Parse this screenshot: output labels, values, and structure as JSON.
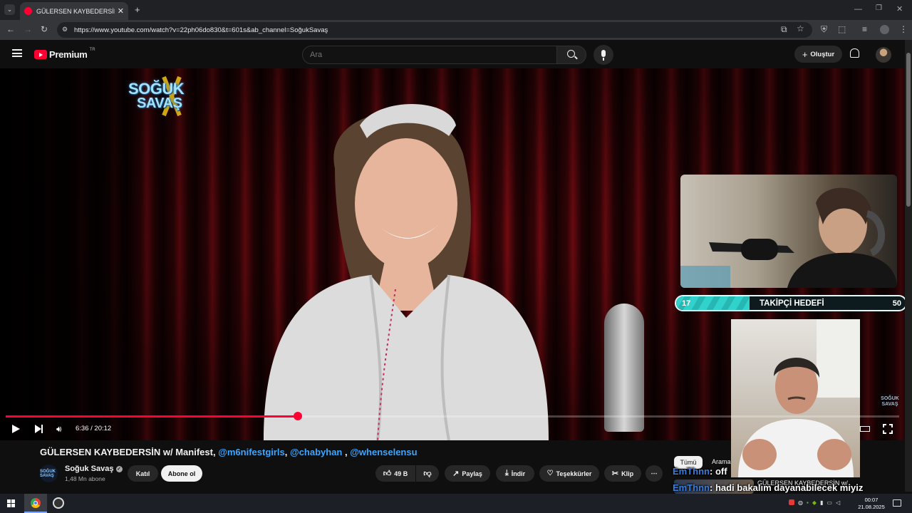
{
  "browser": {
    "tab_title": "GÜLERSEN KAYBEDERSİN w/ M",
    "url": "https://www.youtube.com/watch?v=22ph06do830&t=601s&ab_channel=SoğukSavaş"
  },
  "header": {
    "brand": "Premium",
    "region": "TR",
    "search_placeholder": "Ara",
    "create_label": "Oluştur"
  },
  "video": {
    "logo_line1": "SOĞUK",
    "logo_line2": "SAVAŞ",
    "corner_logo": "SOĞUK SAVAŞ",
    "current_time": "6:36",
    "duration": "20:12",
    "time_display": "6:36 / 20:12",
    "progress_fraction": 0.327
  },
  "overlay": {
    "goal_current": "17",
    "goal_title": "TAKİPÇİ HEDEFİ",
    "goal_target": "50",
    "goal_fraction": 0.32
  },
  "info": {
    "title_main": "GÜLERSEN KAYBEDERSİN w/ Manifest, ",
    "tag1": "@m6nifestgirls",
    "sep1": ", ",
    "tag2": "@chabyhan",
    "sep2": " , ",
    "tag3": "@whenselensu",
    "channel_name": "Soğuk Savaş",
    "channel_logo": "SOĞUK SAVAŞ",
    "subscribers": "1,48 Mn abone",
    "join_label": "Katıl",
    "subscribe_label": "Abone ol",
    "likes": "49 B",
    "share_label": "Paylaş",
    "download_label": "İndir",
    "thanks_label": "Teşekkürler",
    "clip_label": "Klip"
  },
  "chat": {
    "filter_all": "Tümü",
    "filter_search": "Arama",
    "line1_user": "EmThnn",
    "line1_text": ": off",
    "line2_user": "EmThnn",
    "line2_text": ": hadi bakalım dayanabilecek miyiz",
    "related_title": "GÜLERSEN KAYBEDERSİN w/"
  },
  "taskbar": {
    "time": "00:07",
    "date": "21.08.2025"
  },
  "colors": {
    "youtube_red": "#ff0033",
    "link_blue": "#3ea6ff",
    "goal_teal": "#31d2cc"
  }
}
